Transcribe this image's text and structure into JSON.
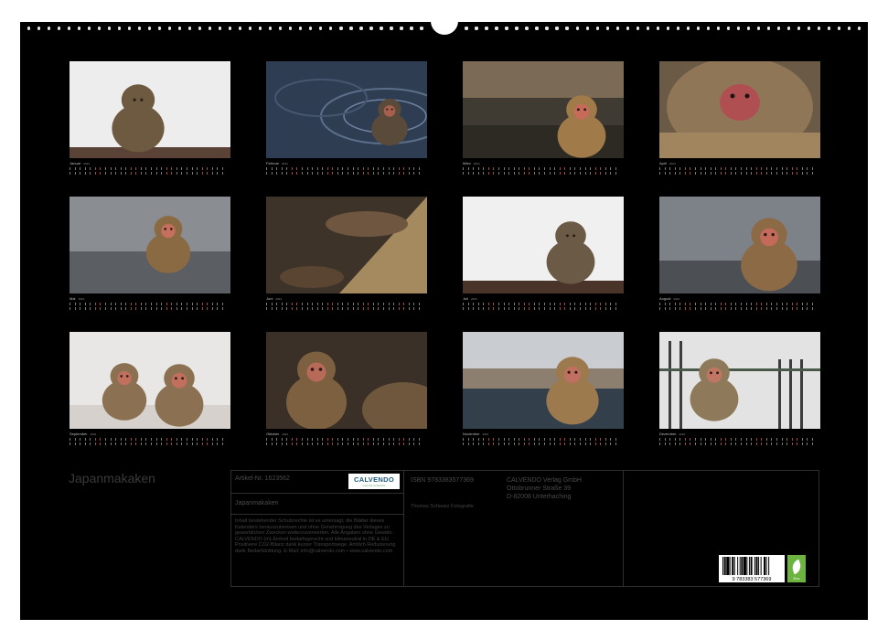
{
  "cover_title": "Japanmakaken",
  "year": "2024",
  "months": [
    {
      "name": "Januar",
      "scene": "snow-sit"
    },
    {
      "name": "Februar",
      "scene": "water-swim"
    },
    {
      "name": "März",
      "scene": "pool-rock"
    },
    {
      "name": "April",
      "scene": "face-close"
    },
    {
      "name": "Mai",
      "scene": "water-grey"
    },
    {
      "name": "Juni",
      "scene": "hands-rock"
    },
    {
      "name": "Juli",
      "scene": "snow-bend"
    },
    {
      "name": "August",
      "scene": "water-grey2"
    },
    {
      "name": "September",
      "scene": "snow-play"
    },
    {
      "name": "Oktober",
      "scene": "eat-snow"
    },
    {
      "name": "November",
      "scene": "pool-sit"
    },
    {
      "name": "Dezember",
      "scene": "fence-baby"
    }
  ],
  "info": {
    "article": "Artikel-Nr. 1623562",
    "title": "Japanmakaken",
    "legal": "Inhalt bestehender Schutzrechte ist es untersagt, die Blätter dieses Kalenders herauszutrennen und ohne Genehmigung des Verlages zu gewerblichen Zwecken weiterzuverwerten. Alle Angaben ohne Gewähr. CALVENDO (m)-Einheit bedarfsgerecht und klimaneutral in DE & EU. Positivere CO2-Bilanz dank kurzer Transportwege. Amtlich Reduzierung dank Bedarfsbildung. E-Mail: info@calvendo.com • www.calvendo.com",
    "isbn": "ISBN 9783383577369",
    "photographer": "Thomas Schwarz Fotografie",
    "publisher_lines": [
      "CALVENDO Verlag GmbH",
      "Ottobrunner Straße 39",
      "D-82008 Unterhaching"
    ],
    "barcode_digits": "9  783383  577369",
    "logo_name": "CALVENDO",
    "logo_sub": "Gute Zeit mit Einsicht",
    "eco_label": "Eco"
  }
}
